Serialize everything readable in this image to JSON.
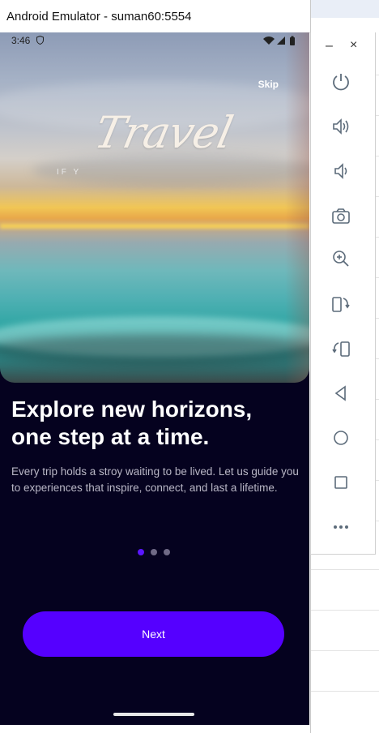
{
  "window": {
    "title": "Android Emulator - suman60:5554"
  },
  "status_bar": {
    "time": "3:46"
  },
  "hero": {
    "word": "Travel",
    "subtext": "IF Y"
  },
  "onboarding": {
    "skip_label": "Skip",
    "headline": "Explore new horizons, one step at a time.",
    "body": "Every trip holds a stroy waiting to be lived. Let us guide you to experiences that inspire, connect, and last a lifetime.",
    "page_count": 3,
    "active_page": 1,
    "next_label": "Next"
  },
  "toolbar": {
    "minimize": "–",
    "close": "×",
    "buttons": [
      "power-icon",
      "volume-up-icon",
      "volume-down-icon",
      "camera-icon",
      "zoom-icon",
      "rotate-right-icon",
      "rotate-left-icon",
      "back-icon",
      "home-icon",
      "overview-icon",
      "more-icon"
    ]
  },
  "colors": {
    "accent": "#5500ff",
    "screen_bg": "#05021f",
    "active_dot": "#5a16ff"
  }
}
